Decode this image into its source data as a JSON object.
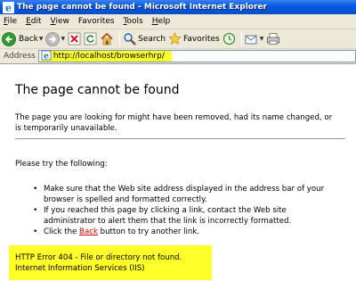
{
  "window": {
    "title": "The page cannot be found - Microsoft Internet Explorer"
  },
  "menu": [
    {
      "underline": "F",
      "rest": "ile"
    },
    {
      "underline": "E",
      "rest": "dit"
    },
    {
      "underline": "V",
      "rest": "iew"
    },
    {
      "underline": "",
      "rest": "Favorites"
    },
    {
      "underline": "T",
      "rest": "ools"
    },
    {
      "underline": "H",
      "rest": "elp"
    }
  ],
  "toolbar": {
    "back_label": "Back",
    "search_label": "Search",
    "favorites_label": "Favorites"
  },
  "address": {
    "label": "Address",
    "url": "http://localhost/browserhrp/"
  },
  "page": {
    "heading": "The page cannot be found",
    "intro_line1": "The page you are looking for might have been removed, had its name changed, or",
    "intro_line2": "is temporarily unavailable.",
    "try_text": "Please try the following:",
    "bullet1_line1": "Make sure that the Web site address displayed in the address bar of your",
    "bullet1_line2": "browser is spelled and formatted correctly.",
    "bullet2_line1": "If you reached this page by clicking a link, contact the Web site",
    "bullet2_line2": "administrator to alert them that the link is incorrectly formatted.",
    "bullet3_before": "Click the ",
    "bullet3_link": "Back",
    "bullet3_after": " button to try another link.",
    "error_line1": "HTTP Error 404 - File or directory not found.",
    "error_line2": "Internet Information Services (IIS)"
  },
  "colors": {
    "titlebar": "#0a5be0",
    "chrome": "#ece9d8",
    "highlight": "#ffff29",
    "link": "#cc0000"
  }
}
